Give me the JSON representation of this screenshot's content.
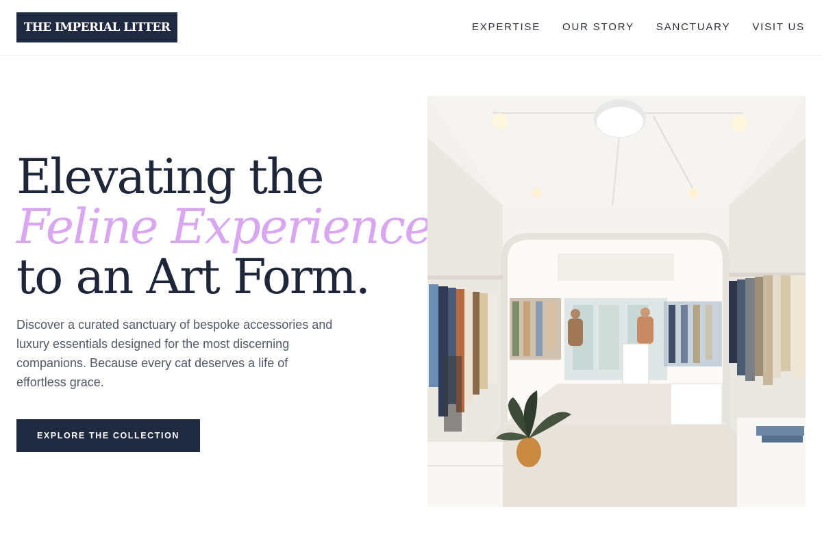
{
  "brand": {
    "logo_text": "THE IMPERIAL LITTER"
  },
  "nav": {
    "items": [
      {
        "label": "EXPERTISE"
      },
      {
        "label": "OUR STORY"
      },
      {
        "label": "SANCTUARY"
      },
      {
        "label": "VISIT US"
      }
    ]
  },
  "hero": {
    "headline_line1": "Elevating the",
    "headline_accent": "Feline Experience",
    "headline_line3": "to an Art Form.",
    "description": "Discover a curated sanctuary of bespoke accessories and luxury essentials designed for the most discerning companions. Because every cat deserves a life of effortless grace.",
    "cta_label": "EXPLORE THE COLLECTION"
  },
  "colors": {
    "navy": "#1f2940",
    "accent_lilac": "#d9a6f0",
    "body_text": "#525866"
  }
}
